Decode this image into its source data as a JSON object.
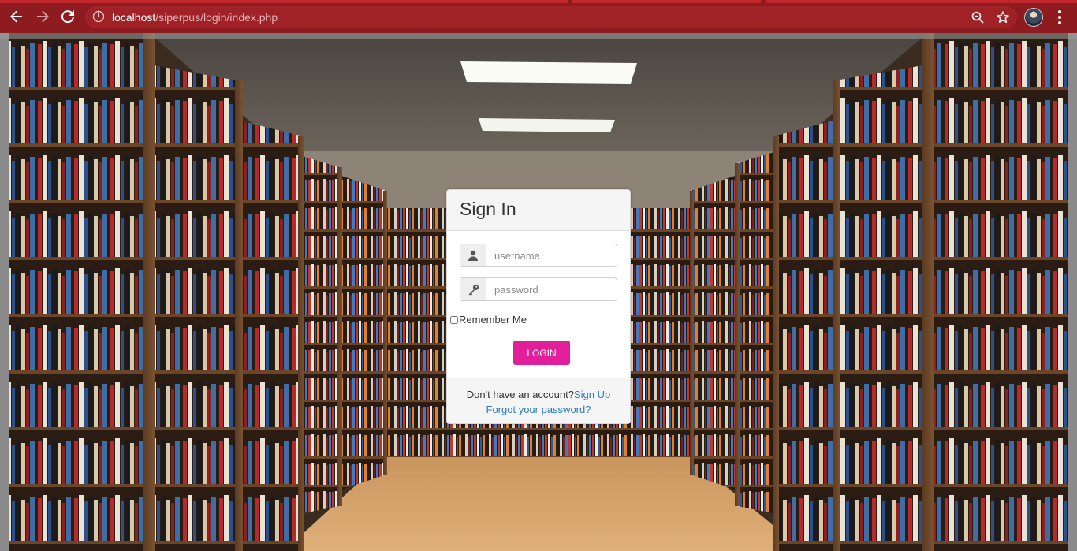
{
  "browser": {
    "url_host": "localhost",
    "url_path": "/siperpus/login/index.php",
    "colors": {
      "frame": "#8e1b1f",
      "omnibox": "#a02227",
      "tab_strip": "#c2272d"
    },
    "icons": [
      "back-arrow-icon",
      "forward-arrow-icon",
      "reload-icon",
      "info-icon",
      "zoom-icon",
      "star-icon",
      "profile-avatar",
      "more-menu-icon"
    ]
  },
  "login": {
    "title": "Sign In",
    "username_placeholder": "username",
    "password_placeholder": "password",
    "remember_label": "Remember Me",
    "login_label": "LOGIN",
    "no_account_text": "Don't have an account?",
    "signup_link": "Sign Up",
    "forgot_link": "Forgot your password?",
    "colors": {
      "login_button": "#e11f9b",
      "link": "#2a7bbf"
    },
    "icons": [
      "user-icon",
      "key-icon"
    ]
  }
}
